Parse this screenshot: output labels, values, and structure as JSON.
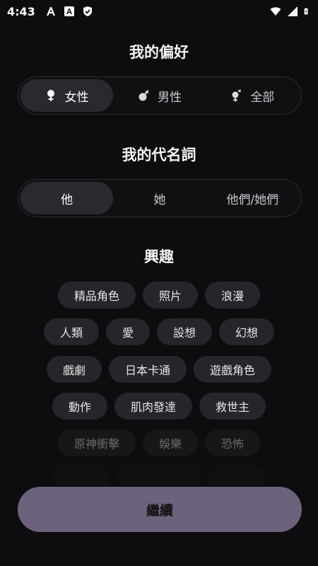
{
  "status_bar": {
    "time": "4:43",
    "left_icons": [
      "font-a-icon",
      "a-box-icon",
      "shield-check-icon"
    ],
    "right_icons": [
      "wifi-icon",
      "signal-icon",
      "battery-charging-icon"
    ]
  },
  "preferences": {
    "title": "我的偏好",
    "options": [
      {
        "label": "女性",
        "icon": "female-icon",
        "selected": true
      },
      {
        "label": "男性",
        "icon": "male-icon",
        "selected": false
      },
      {
        "label": "全部",
        "icon": "all-genders-icon",
        "selected": false
      }
    ]
  },
  "pronouns": {
    "title": "我的代名詞",
    "options": [
      {
        "label": "他",
        "selected": true
      },
      {
        "label": "她",
        "selected": false
      },
      {
        "label": "他們/她們",
        "selected": false
      }
    ]
  },
  "interests": {
    "title": "興趣",
    "rows": [
      [
        "精品角色",
        "照片",
        "浪漫"
      ],
      [
        "人類",
        "愛",
        "設想",
        "幻想"
      ],
      [
        "戲劇",
        "日本卡通",
        "遊戲角色"
      ],
      [
        "動作",
        "肌肉發達",
        "救世主"
      ],
      [
        "原神衝擊",
        "娛樂",
        "恐怖"
      ]
    ]
  },
  "continue_button": {
    "label": "繼續",
    "color": "#6c627c"
  },
  "colors": {
    "background": "#0d0d0f",
    "chip": "#26262a",
    "selected_segment": "#2a2a2e"
  }
}
